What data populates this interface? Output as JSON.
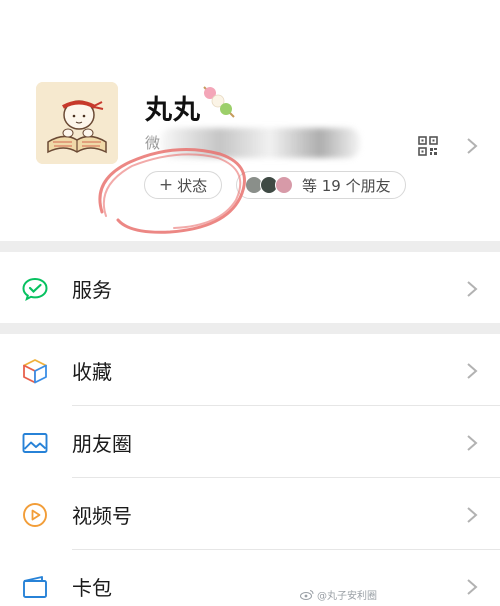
{
  "profile": {
    "nickname": "丸丸",
    "wechat_id_prefix": "微",
    "status_plus": "+",
    "status_label": "状态",
    "friends_text": "等 19 个朋友"
  },
  "menu": {
    "items": [
      {
        "label": "服务",
        "icon": "wechat-pay-icon"
      },
      {
        "label": "收藏",
        "icon": "favorites-cube-icon"
      },
      {
        "label": "朋友圈",
        "icon": "moments-picture-icon"
      },
      {
        "label": "视频号",
        "icon": "channels-play-icon"
      },
      {
        "label": "卡包",
        "icon": "card-wallet-icon"
      }
    ]
  },
  "watermark": {
    "text": "@丸子安利圈"
  },
  "colors": {
    "pay_green": "#07c160",
    "moments_blue": "#2782d7",
    "channels_orange": "#f29d38",
    "card_blue": "#2782d7",
    "scribble_red": "#e9726f",
    "page_gap": "#ededed"
  }
}
